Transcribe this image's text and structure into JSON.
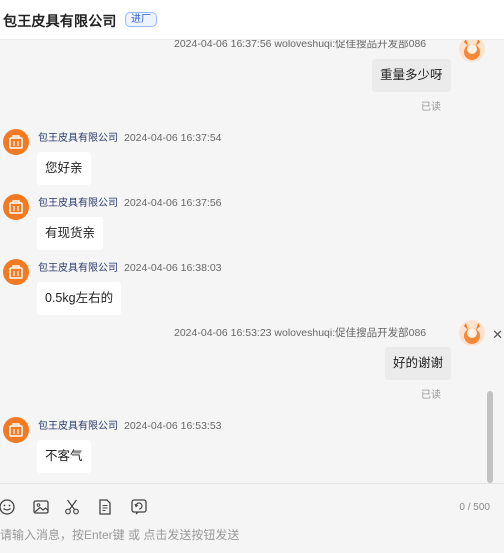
{
  "header": {
    "title": "包王皮具有限公司",
    "tag": "进厂"
  },
  "messages": {
    "top_meta": "2024-04-06 16:37:56   woloveshuqi:促佳搜品开发部086",
    "m1": {
      "text": "重量多少呀",
      "status": "已读"
    },
    "m2": {
      "sender": "包王皮具有限公司",
      "time": "2024-04-06 16:37:54",
      "text": "您好亲"
    },
    "m3": {
      "sender": "包王皮具有限公司",
      "time": "2024-04-06 16:37:56",
      "text": "有现货亲"
    },
    "m4": {
      "sender": "包王皮具有限公司",
      "time": "2024-04-06 16:38:03",
      "text": "0.5kg左右的"
    },
    "m5": {
      "meta": "2024-04-06 16:53:23   woloveshuqi:促佳搜品开发部086",
      "text": "好的谢谢",
      "status": "已读"
    },
    "m6": {
      "sender": "包王皮具有限公司",
      "time": "2024-04-06 16:53:53",
      "text": "不客气"
    }
  },
  "composer": {
    "tools": [
      "emoji-icon",
      "image-icon",
      "scissors-icon",
      "document-icon",
      "refresh-chat-icon"
    ],
    "counter": "0 / 500",
    "placeholder": "请输入消息，按Enter键 或 点击发送按钮发送"
  },
  "colors": {
    "brand_orange": "#f47a22",
    "tag_blue": "#2f5fd0"
  }
}
